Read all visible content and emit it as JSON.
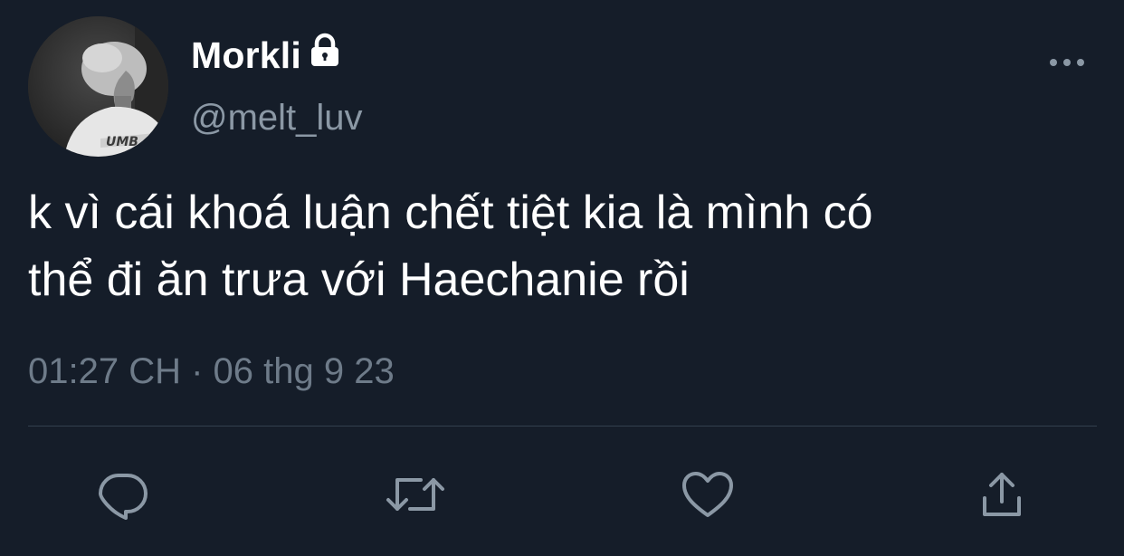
{
  "tweet": {
    "author": {
      "display_name": "Morkli",
      "handle": "@melt_luv",
      "protected_icon": "lock-icon",
      "avatar": "grayscale-profile-photo"
    },
    "text_lines": [
      "k vì cái khoá luận chết tiệt kia là mình có",
      "thể đi ăn trưa với Haechanie rồi"
    ],
    "timestamp": "01:27 CH · 06 thg 9 23",
    "more_icon": "more-horizontal-icon",
    "actions": [
      {
        "name": "reply",
        "icon": "reply-icon"
      },
      {
        "name": "retweet",
        "icon": "retweet-icon"
      },
      {
        "name": "like",
        "icon": "heart-icon"
      },
      {
        "name": "share",
        "icon": "share-icon"
      }
    ]
  },
  "colors": {
    "background": "#151d29",
    "primary_text": "#ffffff",
    "secondary_text": "#8b98a5",
    "timestamp_text": "#6e7b89",
    "divider": "#33404e",
    "icon": "#8b98a5"
  }
}
